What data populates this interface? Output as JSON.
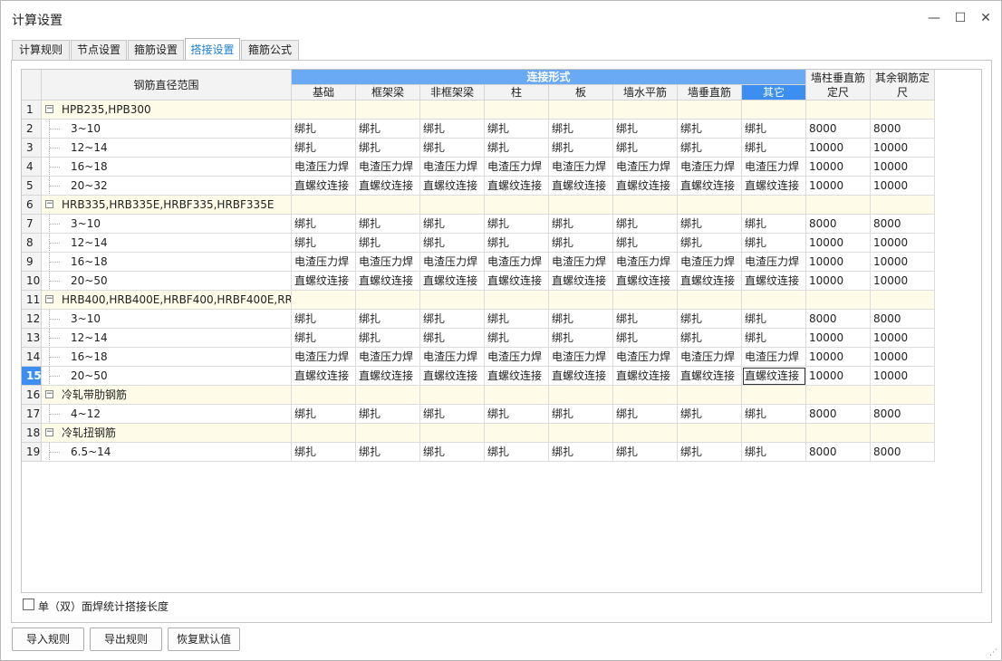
{
  "window": {
    "title": "计算设置",
    "minimize_icon": "minimize-icon",
    "maximize_icon": "maximize-icon",
    "close_icon": "close-icon"
  },
  "tabs": [
    "计算规则",
    "节点设置",
    "箍筋设置",
    "搭接设置",
    "箍筋公式"
  ],
  "active_tab": "搭接设置",
  "table": {
    "header_range": "钢筋直径范围",
    "header_group": "连接形式",
    "columns": [
      "基础",
      "框架梁",
      "非框架梁",
      "柱",
      "板",
      "墙水平筋",
      "墙垂直筋",
      "其它"
    ],
    "header_wall_vertical": "墙柱垂直筋定尺",
    "header_other_fixed": "其余钢筋定尺",
    "rows": [
      {
        "num": "1",
        "group": true,
        "label": "HPB235,HPB300"
      },
      {
        "num": "2",
        "label": "3~10",
        "values": [
          "绑扎",
          "绑扎",
          "绑扎",
          "绑扎",
          "绑扎",
          "绑扎",
          "绑扎",
          "绑扎"
        ],
        "fixed1": "8000",
        "fixed2": "8000"
      },
      {
        "num": "3",
        "label": "12~14",
        "values": [
          "绑扎",
          "绑扎",
          "绑扎",
          "绑扎",
          "绑扎",
          "绑扎",
          "绑扎",
          "绑扎"
        ],
        "fixed1": "10000",
        "fixed2": "10000"
      },
      {
        "num": "4",
        "label": "16~18",
        "values": [
          "电渣压力焊",
          "电渣压力焊",
          "电渣压力焊",
          "电渣压力焊",
          "电渣压力焊",
          "电渣压力焊",
          "电渣压力焊",
          "电渣压力焊"
        ],
        "fixed1": "10000",
        "fixed2": "10000"
      },
      {
        "num": "5",
        "label": "20~32",
        "values": [
          "直螺纹连接",
          "直螺纹连接",
          "直螺纹连接",
          "直螺纹连接",
          "直螺纹连接",
          "直螺纹连接",
          "直螺纹连接",
          "直螺纹连接"
        ],
        "fixed1": "10000",
        "fixed2": "10000"
      },
      {
        "num": "6",
        "group": true,
        "label": "HRB335,HRB335E,HRBF335,HRBF335E"
      },
      {
        "num": "7",
        "label": "3~10",
        "values": [
          "绑扎",
          "绑扎",
          "绑扎",
          "绑扎",
          "绑扎",
          "绑扎",
          "绑扎",
          "绑扎"
        ],
        "fixed1": "8000",
        "fixed2": "8000"
      },
      {
        "num": "8",
        "label": "12~14",
        "values": [
          "绑扎",
          "绑扎",
          "绑扎",
          "绑扎",
          "绑扎",
          "绑扎",
          "绑扎",
          "绑扎"
        ],
        "fixed1": "10000",
        "fixed2": "10000"
      },
      {
        "num": "9",
        "label": "16~18",
        "values": [
          "电渣压力焊",
          "电渣压力焊",
          "电渣压力焊",
          "电渣压力焊",
          "电渣压力焊",
          "电渣压力焊",
          "电渣压力焊",
          "电渣压力焊"
        ],
        "fixed1": "10000",
        "fixed2": "10000"
      },
      {
        "num": "10",
        "label": "20~50",
        "values": [
          "直螺纹连接",
          "直螺纹连接",
          "直螺纹连接",
          "直螺纹连接",
          "直螺纹连接",
          "直螺纹连接",
          "直螺纹连接",
          "直螺纹连接"
        ],
        "fixed1": "10000",
        "fixed2": "10000"
      },
      {
        "num": "11",
        "group": true,
        "label": "HRB400,HRB400E,HRBF400,HRBF400E,RR..."
      },
      {
        "num": "12",
        "label": "3~10",
        "values": [
          "绑扎",
          "绑扎",
          "绑扎",
          "绑扎",
          "绑扎",
          "绑扎",
          "绑扎",
          "绑扎"
        ],
        "fixed1": "8000",
        "fixed2": "8000"
      },
      {
        "num": "13",
        "label": "12~14",
        "values": [
          "绑扎",
          "绑扎",
          "绑扎",
          "绑扎",
          "绑扎",
          "绑扎",
          "绑扎",
          "绑扎"
        ],
        "fixed1": "10000",
        "fixed2": "10000"
      },
      {
        "num": "14",
        "label": "16~18",
        "values": [
          "电渣压力焊",
          "电渣压力焊",
          "电渣压力焊",
          "电渣压力焊",
          "电渣压力焊",
          "电渣压力焊",
          "电渣压力焊",
          "电渣压力焊"
        ],
        "fixed1": "10000",
        "fixed2": "10000"
      },
      {
        "num": "15",
        "label": "20~50",
        "values": [
          "直螺纹连接",
          "直螺纹连接",
          "直螺纹连接",
          "直螺纹连接",
          "直螺纹连接",
          "直螺纹连接",
          "直螺纹连接",
          "直螺纹连接"
        ],
        "fixed1": "10000",
        "fixed2": "10000",
        "selected": true
      },
      {
        "num": "16",
        "group": true,
        "label": "冷轧带肋钢筋"
      },
      {
        "num": "17",
        "label": "4~12",
        "values": [
          "绑扎",
          "绑扎",
          "绑扎",
          "绑扎",
          "绑扎",
          "绑扎",
          "绑扎",
          "绑扎"
        ],
        "fixed1": "8000",
        "fixed2": "8000"
      },
      {
        "num": "18",
        "group": true,
        "label": "冷轧扭钢筋"
      },
      {
        "num": "19",
        "label": "6.5~14",
        "values": [
          "绑扎",
          "绑扎",
          "绑扎",
          "绑扎",
          "绑扎",
          "绑扎",
          "绑扎",
          "绑扎"
        ],
        "fixed1": "8000",
        "fixed2": "8000"
      }
    ]
  },
  "checkbox_label": "单（双）面焊统计搭接长度",
  "checkbox_checked": false,
  "buttons": {
    "import": "导入规则",
    "export": "导出规则",
    "restore": "恢复默认值"
  }
}
